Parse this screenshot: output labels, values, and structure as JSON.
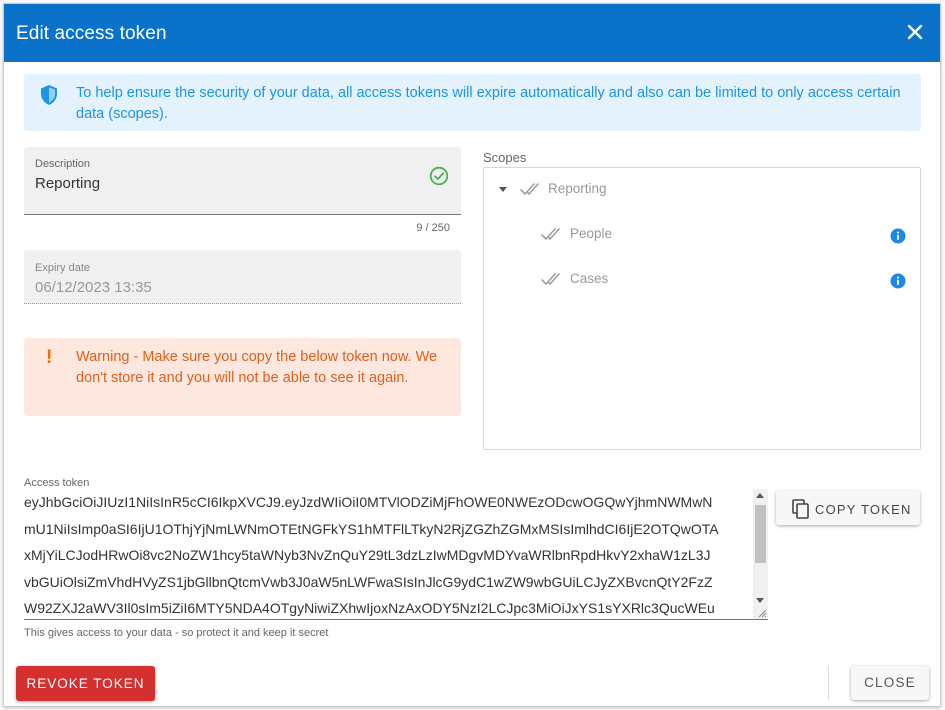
{
  "dialog": {
    "title": "Edit access token",
    "close_icon": "close-icon"
  },
  "banner": {
    "text": "To help ensure the security of your data, all access tokens will expire automatically and also can be limited to only access certain data (scopes).",
    "icon": "shield-icon",
    "color": "#1a95e8"
  },
  "description": {
    "label": "Description",
    "value": "Reporting",
    "counter": "9 / 250",
    "status_icon": "check-circle-icon"
  },
  "expiry": {
    "label": "Expiry date",
    "value": "06/12/2023 13:35"
  },
  "warning": {
    "mark": "!",
    "text": "Warning - Make sure you copy the below token now. We don't store it and you will not be able to see it again."
  },
  "scopes": {
    "label": "Scopes",
    "items": [
      {
        "label": "Reporting",
        "level": 0,
        "expanded": true,
        "icon": "double-check-icon"
      },
      {
        "label": "People",
        "level": 1,
        "icon": "double-check-icon",
        "info_icon": "info-icon"
      },
      {
        "label": "Cases",
        "level": 1,
        "icon": "double-check-icon",
        "info_icon": "info-icon"
      }
    ]
  },
  "token": {
    "label": "Access token",
    "lines": [
      "eyJhbGciOiJIUzI1NiIsInR5cCI6IkpXVCJ9.eyJzdWIiOiI0MTVlODZiMjFhOWE0NWEzODcwOGQwYjhmNWMwN",
      "mU1NiIsImp0aSI6IjU1OThjYjNmLWNmOTEtNGFkYS1hMTFlLTkyN2RjZGZhZGMxMSIsImlhdCI6IjE2OTQwOTA",
      "xMjYiLCJodHRwOi8vc2NoZW1hcy5taWNyb3NvZnQuY29tL3dzLzIwMDgvMDYvaWRlbnRpdHkvY2xhaW1zL3J",
      "vbGUiOlsiZmVhdHVyZS1jbGllbnQtcmVwb3J0aW5nLWFwaSIsInJlcG9ydC1wZW9wbGUiLCJyZXBvcnQtY2FzZ",
      "W92ZXJ2aWV3Il0sIm5iZiI6MTY5NDA4OTgyNiwiZXhwIjoxNzAxODY5NzI2LCJpc3MiOiJxYS1sYXRlc3QucWEu"
    ],
    "hint": "This gives access to your data - so protect it and keep it secret"
  },
  "buttons": {
    "copy": "COPY TOKEN",
    "copy_icon": "copy-icon",
    "revoke": "REVOKE TOKEN",
    "close": "CLOSE"
  },
  "colors": {
    "header": "#0a72c8",
    "revoke": "#d3302f",
    "warning_text": "#e2601c",
    "success": "#4caf50",
    "info": "#1e88e5"
  }
}
